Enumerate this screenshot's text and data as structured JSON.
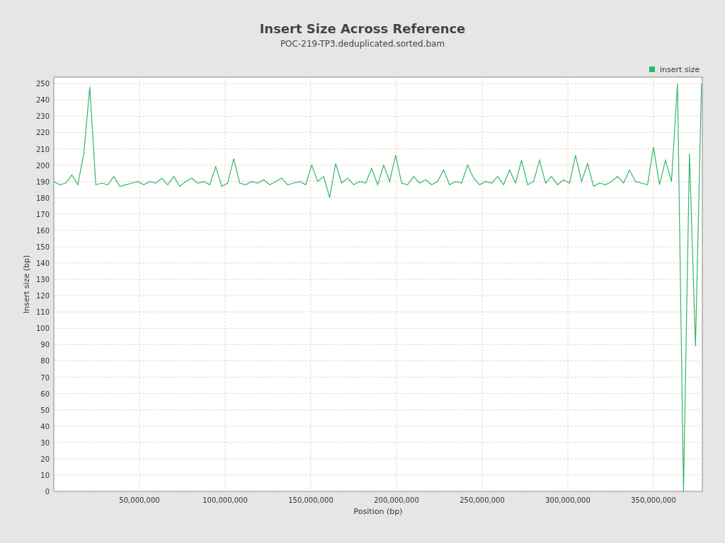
{
  "chart_data": {
    "type": "line",
    "title": "Insert Size Across Reference",
    "subtitle": "POC-219-TP3.deduplicated.sorted.bam",
    "xlabel": "Position (bp)",
    "ylabel": "Insert size (bp)",
    "x": [
      0,
      3500000,
      7000000,
      10500000,
      14000000,
      17500000,
      21000000,
      24500000,
      28000000,
      31500000,
      35000000,
      38500000,
      42000000,
      45500000,
      49000000,
      52500000,
      56000000,
      59500000,
      63000000,
      66500000,
      70000000,
      73500000,
      77000000,
      80500000,
      84000000,
      87500000,
      91000000,
      94500000,
      98000000,
      101500000,
      105000000,
      108500000,
      112000000,
      115500000,
      119000000,
      122500000,
      126000000,
      129500000,
      133000000,
      136500000,
      140000000,
      143500000,
      147000000,
      150500000,
      154000000,
      157500000,
      161000000,
      164500000,
      168000000,
      171500000,
      175000000,
      178500000,
      182000000,
      185500000,
      189000000,
      192500000,
      196000000,
      199500000,
      203000000,
      206500000,
      210000000,
      213500000,
      217000000,
      220500000,
      224000000,
      227500000,
      231000000,
      234500000,
      238000000,
      241500000,
      245000000,
      248500000,
      252000000,
      255500000,
      259000000,
      262500000,
      266000000,
      269500000,
      273000000,
      276500000,
      280000000,
      283500000,
      287000000,
      290500000,
      294000000,
      297500000,
      301000000,
      304500000,
      308000000,
      311500000,
      315000000,
      318500000,
      322000000,
      325500000,
      329000000,
      332500000,
      336000000,
      339500000,
      343000000,
      346500000,
      350000000,
      353500000,
      357000000,
      360500000,
      364000000,
      367500000,
      371000000,
      374500000,
      378000000
    ],
    "series": [
      {
        "name": "insert size",
        "color": "#2eb86c",
        "values": [
          190,
          188,
          189,
          194,
          188,
          207,
          248,
          188,
          189,
          188,
          193,
          187,
          188,
          189,
          190,
          188,
          190,
          189,
          192,
          188,
          193,
          187,
          190,
          192,
          189,
          190,
          188,
          199,
          187,
          189,
          204,
          189,
          188,
          190,
          189,
          191,
          188,
          190,
          192,
          188,
          189,
          190,
          188,
          200,
          190,
          193,
          180,
          201,
          189,
          192,
          188,
          190,
          189,
          198,
          188,
          200,
          190,
          206,
          189,
          188,
          193,
          189,
          191,
          188,
          190,
          197,
          188,
          190,
          189,
          200,
          192,
          188,
          190,
          189,
          193,
          188,
          197,
          189,
          203,
          188,
          190,
          203,
          189,
          193,
          188,
          191,
          189,
          206,
          190,
          201,
          187,
          189,
          188,
          190,
          193,
          189,
          197,
          190,
          189,
          188,
          211,
          188,
          203,
          190,
          250,
          0,
          207,
          89,
          250
        ]
      }
    ],
    "grid": true,
    "xlim": [
      0,
      378500000
    ],
    "ylim": [
      0,
      254
    ],
    "xticks": [
      {
        "value": 50000000,
        "label": "50,000,000"
      },
      {
        "value": 100000000,
        "label": "100,000,000"
      },
      {
        "value": 150000000,
        "label": "150,000,000"
      },
      {
        "value": 200000000,
        "label": "200,000,000"
      },
      {
        "value": 250000000,
        "label": "250,000,000"
      },
      {
        "value": 300000000,
        "label": "300,000,000"
      },
      {
        "value": 350000000,
        "label": "350,000,000"
      }
    ],
    "yticks": [
      0,
      10,
      20,
      30,
      40,
      50,
      60,
      70,
      80,
      90,
      100,
      110,
      120,
      130,
      140,
      150,
      160,
      170,
      180,
      190,
      200,
      210,
      220,
      230,
      240,
      250
    ]
  }
}
